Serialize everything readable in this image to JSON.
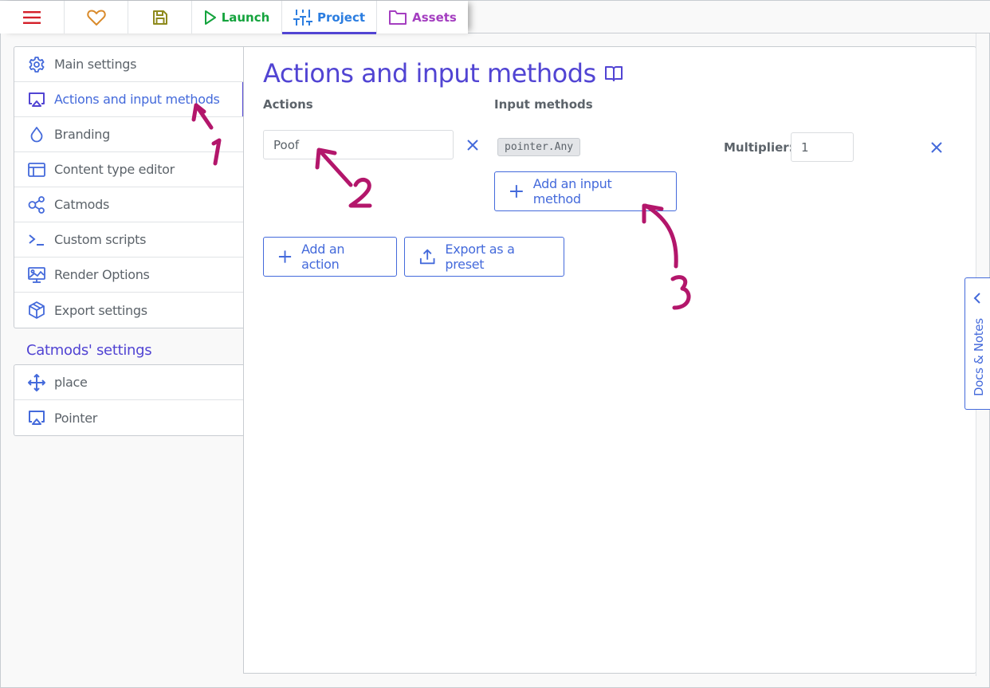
{
  "topnav": {
    "tabs": [
      {
        "id": "menu",
        "icon": "hamburger-menu-icon",
        "label": "",
        "color": "#d4202a"
      },
      {
        "id": "favorite",
        "icon": "heart-icon",
        "label": "",
        "color": "#d98a2a"
      },
      {
        "id": "save",
        "icon": "save-icon",
        "label": "",
        "color": "#8e8a1d"
      },
      {
        "id": "launch",
        "icon": "play-icon",
        "label": "Launch",
        "color": "#14a33d"
      },
      {
        "id": "project",
        "icon": "sliders-icon",
        "label": "Project",
        "color": "#2b7de0",
        "active": true
      },
      {
        "id": "assets",
        "icon": "folder-icon",
        "label": "Assets",
        "color": "#a43ec0"
      }
    ]
  },
  "sidebar": {
    "items": [
      {
        "label": "Main settings",
        "icon": "gear-icon"
      },
      {
        "label": "Actions and input methods",
        "icon": "airplay-icon",
        "active": true
      },
      {
        "label": "Branding",
        "icon": "droplet-icon"
      },
      {
        "label": "Content type editor",
        "icon": "layout-icon"
      },
      {
        "label": "Catmods",
        "icon": "share-nodes-icon"
      },
      {
        "label": "Custom scripts",
        "icon": "terminal-icon"
      },
      {
        "label": "Render Options",
        "icon": "monitor-image-icon"
      },
      {
        "label": "Export settings",
        "icon": "package-icon"
      }
    ],
    "catmods_heading": "Catmods' settings",
    "catmod_items": [
      {
        "label": "place",
        "icon": "move-icon"
      },
      {
        "label": "Pointer",
        "icon": "airplay-icon"
      }
    ]
  },
  "main": {
    "title": "Actions and input methods",
    "title_icon": "book-icon",
    "actions_label": "Actions",
    "input_methods_label": "Input methods",
    "actions": [
      {
        "name": "Poof",
        "input_methods": [
          {
            "code": "pointer.Any",
            "multiplier_label": "Multiplier:",
            "multiplier": "1"
          }
        ]
      }
    ],
    "add_input_method_label": "Add an input method",
    "add_action_label": "Add an action",
    "export_preset_label": "Export as a preset"
  },
  "docs_panel": {
    "label": "Docs & Notes"
  },
  "annotations": {
    "color": "#b3166b",
    "marks": [
      "1",
      "2",
      "3"
    ]
  },
  "colors": {
    "accent": "#446adb",
    "heading": "#5144d3",
    "text": "#5c636a",
    "border": "#c8ccd1"
  }
}
